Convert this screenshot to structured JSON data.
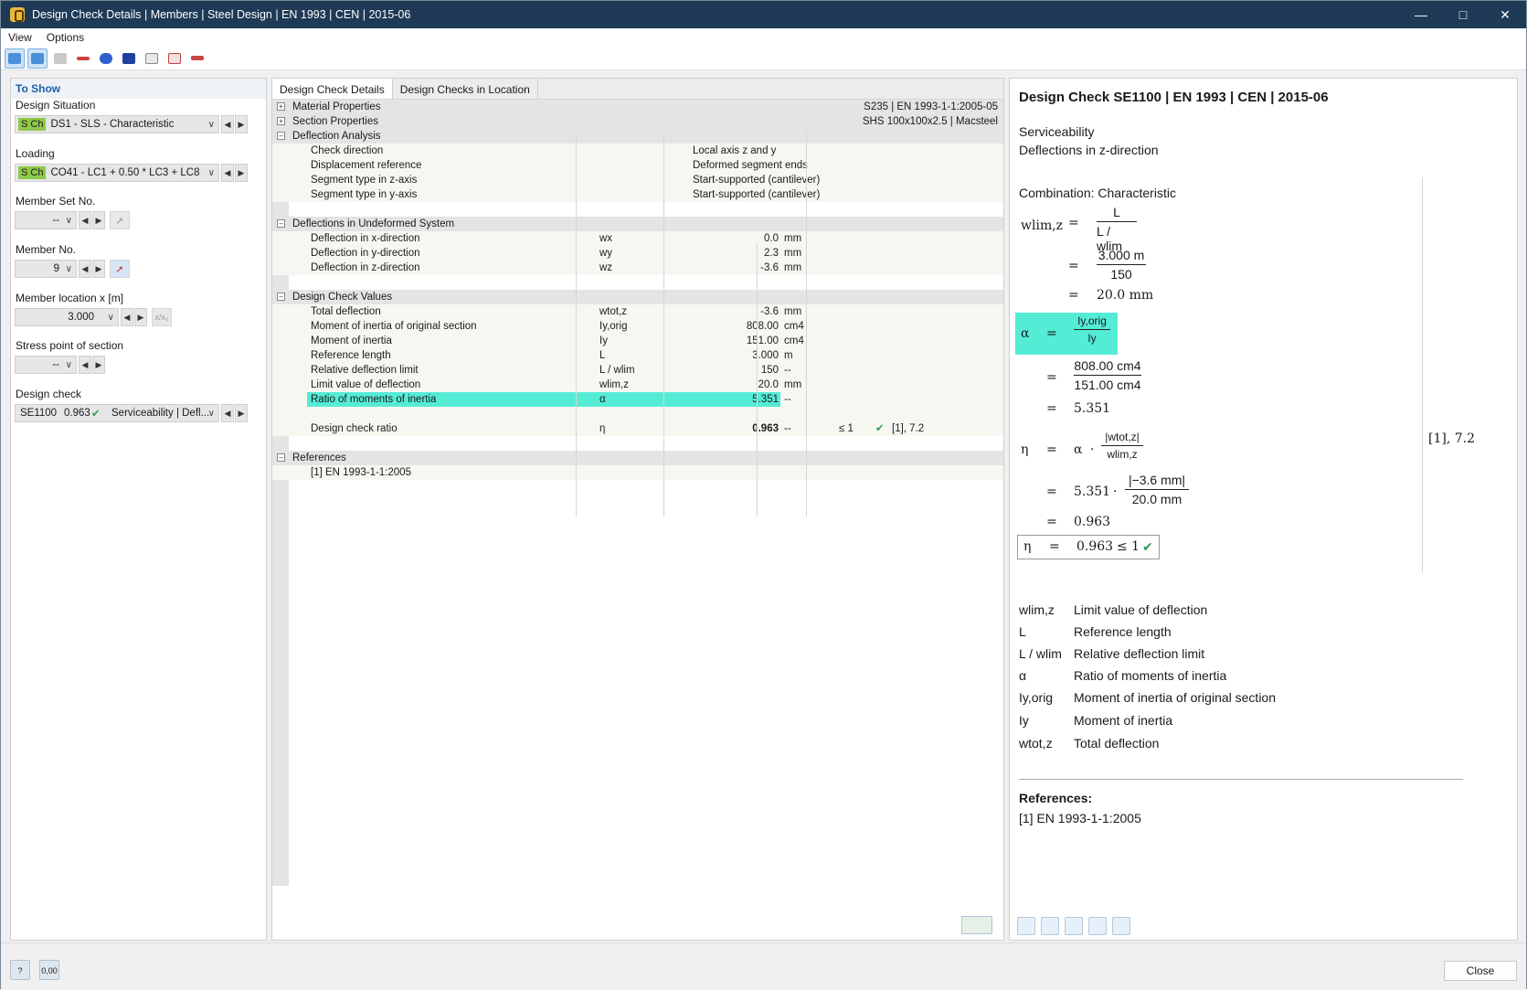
{
  "window": {
    "title": "Design Check Details | Members | Steel Design | EN 1993 | CEN | 2015-06"
  },
  "menu": {
    "view": "View",
    "options": "Options"
  },
  "left": {
    "header": "To Show",
    "design_situation": {
      "label": "Design Situation",
      "tag": "S Ch",
      "value": "DS1 - SLS - Characteristic"
    },
    "loading": {
      "label": "Loading",
      "tag": "S Ch",
      "value": "CO41 - LC1 + 0.50 * LC3 + LC8"
    },
    "member_set": {
      "label": "Member Set No.",
      "value": "--"
    },
    "member_no": {
      "label": "Member No.",
      "value": "9"
    },
    "member_location": {
      "label": "Member location x [m]",
      "value": "3.000"
    },
    "stress_point": {
      "label": "Stress point of section",
      "value": "--"
    },
    "design_check": {
      "label": "Design check",
      "id": "SE1100",
      "ratio": "0.963",
      "value": "Serviceability | Defl..."
    }
  },
  "center": {
    "tabs": [
      "Design Check Details",
      "Design Checks in Location"
    ],
    "material": {
      "label": "Material Properties",
      "value": "S235 | EN 1993-1-1:2005-05"
    },
    "section": {
      "label": "Section Properties",
      "value": "SHS 100x100x2.5 | Macsteel"
    },
    "deflection_analysis": {
      "label": "Deflection Analysis",
      "rows": [
        {
          "name": "Check direction",
          "value": "Local axis z and y"
        },
        {
          "name": "Displacement reference",
          "value": "Deformed segment ends"
        },
        {
          "name": "Segment type in z-axis",
          "value": "Start-supported (cantilever)"
        },
        {
          "name": "Segment type in y-axis",
          "value": "Start-supported (cantilever)"
        }
      ]
    },
    "undeformed": {
      "label": "Deflections in Undeformed System",
      "rows": [
        {
          "name": "Deflection in x-direction",
          "sym": "wx",
          "value": "0.0",
          "unit": "mm"
        },
        {
          "name": "Deflection in y-direction",
          "sym": "wy",
          "value": "2.3",
          "unit": "mm"
        },
        {
          "name": "Deflection in z-direction",
          "sym": "wz",
          "value": "-3.6",
          "unit": "mm"
        }
      ]
    },
    "check_values": {
      "label": "Design Check Values",
      "rows": [
        {
          "name": "Total deflection",
          "sym": "wtot,z",
          "value": "-3.6",
          "unit": "mm"
        },
        {
          "name": "Moment of inertia of original section",
          "sym": "Iy,orig",
          "value": "808.00",
          "unit": "cm4"
        },
        {
          "name": "Moment of inertia",
          "sym": "Iy",
          "value": "151.00",
          "unit": "cm4"
        },
        {
          "name": "Reference length",
          "sym": "L",
          "value": "3.000",
          "unit": "m"
        },
        {
          "name": "Relative deflection limit",
          "sym": "L / wlim",
          "value": "150",
          "unit": "--"
        },
        {
          "name": "Limit value of deflection",
          "sym": "wlim,z",
          "value": "20.0",
          "unit": "mm"
        },
        {
          "name": "Ratio of moments of inertia",
          "sym": "α",
          "value": "5.351",
          "unit": "--"
        }
      ],
      "ratio": {
        "name": "Design check ratio",
        "sym": "η",
        "value": "0.963",
        "unit": "--",
        "cmp": "≤ 1",
        "ref": "[1], 7.2"
      }
    },
    "references": {
      "label": "References",
      "item": "[1]  EN 1993-1-1:2005"
    }
  },
  "right": {
    "title": "Design Check SE1100 | EN 1993 | CEN | 2015-06",
    "line1": "Serviceability",
    "line2": "Deflections in z-direction",
    "combination": "Combination: Characteristic",
    "eq": {
      "wlim_sym": "wlim,z",
      "eqsign": "=",
      "L": "L",
      "Lw": "L / wlim",
      "n1": "3.000 m",
      "d1": "150",
      "r1": "20.0 mm",
      "alpha": "α",
      "iyorig": "Iy,orig",
      "iy": "Iy",
      "n2": "808.00 cm4",
      "d2": "151.00 cm4",
      "r2": "5.351",
      "eta": "η",
      "dot": "·",
      "wtot": "|wtot,z|",
      "wlim2": "wlim,z",
      "n3": "|−3.6 mm|",
      "d3": "20.0 mm",
      "r3": "0.963",
      "final": "0.963",
      "le": "≤ 1",
      "ref": "[1], 7.2"
    },
    "legend": [
      {
        "sym": "wlim,z",
        "text": "Limit value of deflection"
      },
      {
        "sym": "L",
        "text": "Reference length"
      },
      {
        "sym": "L / wlim",
        "text": "Relative deflection limit"
      },
      {
        "sym": "α",
        "text": "Ratio of moments of inertia"
      },
      {
        "sym": "Iy,orig",
        "text": "Moment of inertia of original section"
      },
      {
        "sym": "Iy",
        "text": "Moment of inertia"
      },
      {
        "sym": "wtot,z",
        "text": "Total deflection"
      }
    ],
    "references_title": "References:",
    "references_item": "[1]   EN 1993-1-1:2005"
  },
  "footer": {
    "close": "Close",
    "units_icon": "0,00"
  },
  "colors": {
    "titlebar": "#1e3a56",
    "highlight": "#55ecd6",
    "tag": "#8fc94a",
    "check": "#27a04a"
  }
}
